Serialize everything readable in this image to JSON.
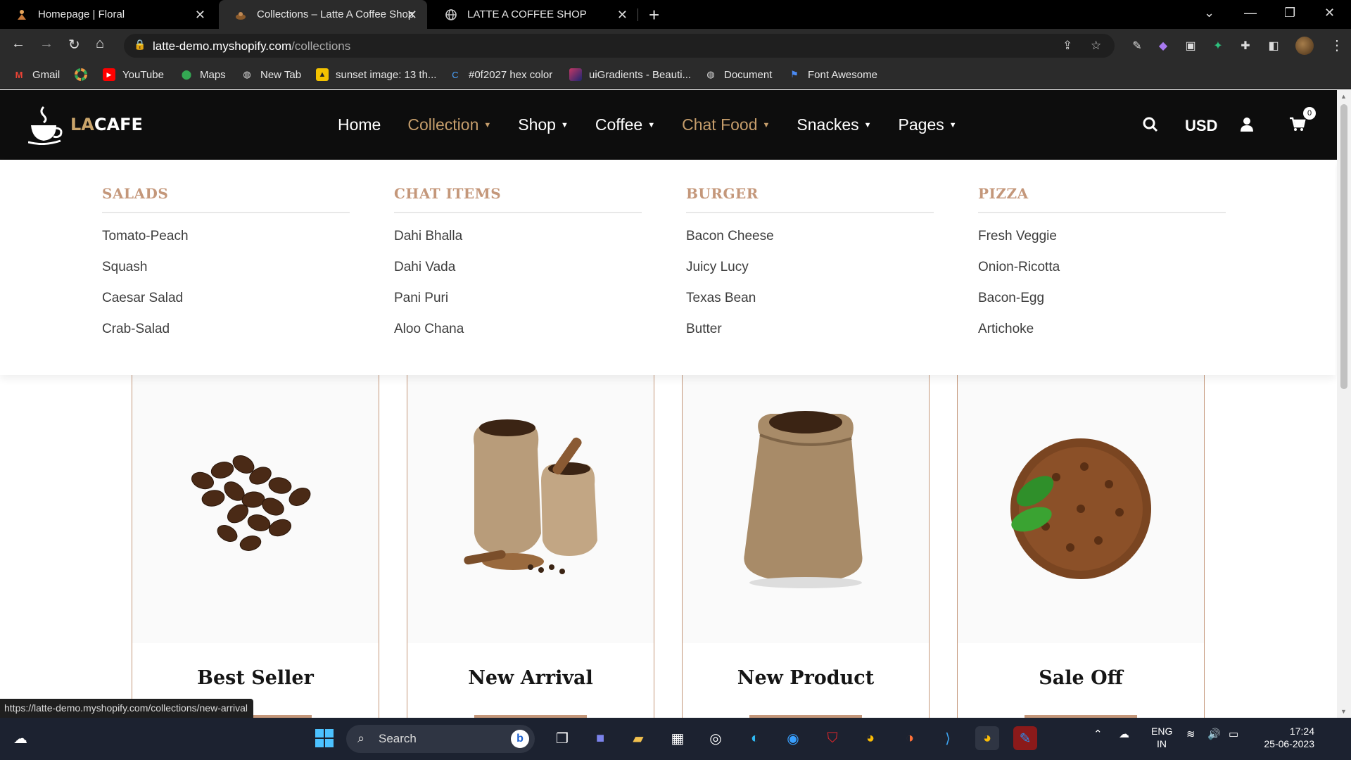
{
  "browser": {
    "tabs": [
      {
        "title": "Homepage | Floral",
        "active": false
      },
      {
        "title": "Collections – Latte A Coffee Shop",
        "active": true
      },
      {
        "title": "LATTE A COFFEE SHOP",
        "active": false
      }
    ],
    "url_host": "latte-demo.myshopify.com",
    "url_path": "/collections",
    "bookmarks": [
      "Gmail",
      "YouTube",
      "Maps",
      "New Tab",
      "sunset image: 13 th...",
      "#0f2027 hex color",
      "uiGradients - Beauti...",
      "Document",
      "Font Awesome"
    ],
    "status_url": "https://latte-demo.myshopify.com/collections/new-arrival"
  },
  "site": {
    "logo_la": "LA",
    "logo_cafe": "CAFE",
    "menu": [
      {
        "label": "Home",
        "dropdown": false,
        "accent": false
      },
      {
        "label": "Collection",
        "dropdown": true,
        "accent": true
      },
      {
        "label": "Shop",
        "dropdown": true,
        "accent": false
      },
      {
        "label": "Coffee",
        "dropdown": true,
        "accent": false
      },
      {
        "label": "Chat Food",
        "dropdown": true,
        "accent": true
      },
      {
        "label": "Snackes",
        "dropdown": true,
        "accent": false
      },
      {
        "label": "Pages",
        "dropdown": true,
        "accent": false
      }
    ],
    "currency": "USD",
    "cart_count": "0"
  },
  "mega_menu": [
    {
      "heading": "SALADS",
      "items": [
        "Tomato-Peach",
        "Squash",
        "Caesar Salad",
        "Crab-Salad"
      ]
    },
    {
      "heading": "CHAT ITEMS",
      "items": [
        "Dahi Bhalla",
        "Dahi Vada",
        "Pani Puri",
        "Aloo Chana"
      ]
    },
    {
      "heading": "BURGER",
      "items": [
        "Bacon Cheese",
        "Juicy Lucy",
        "Texas Bean",
        "Butter"
      ]
    },
    {
      "heading": "PIZZA",
      "items": [
        "Fresh Veggie",
        "Onion-Ricotta",
        "Bacon-Egg",
        "Artichoke"
      ]
    }
  ],
  "collections": [
    {
      "name": "Best Seller",
      "image": "coffee-beans-pile"
    },
    {
      "name": "New Arrival",
      "image": "coffee-sacks-scoops"
    },
    {
      "name": "New Product",
      "image": "coffee-burlap-sack"
    },
    {
      "name": "Sale Off",
      "image": "coffee-beans-leaves"
    }
  ],
  "taskbar": {
    "search_label": "Search",
    "lang_line1": "ENG",
    "lang_line2": "IN",
    "time": "17:24",
    "date": "25-06-2023"
  },
  "colors": {
    "accent": "#c59d6b",
    "header_bg": "#0d0d0d",
    "card_border": "#c4977a"
  }
}
